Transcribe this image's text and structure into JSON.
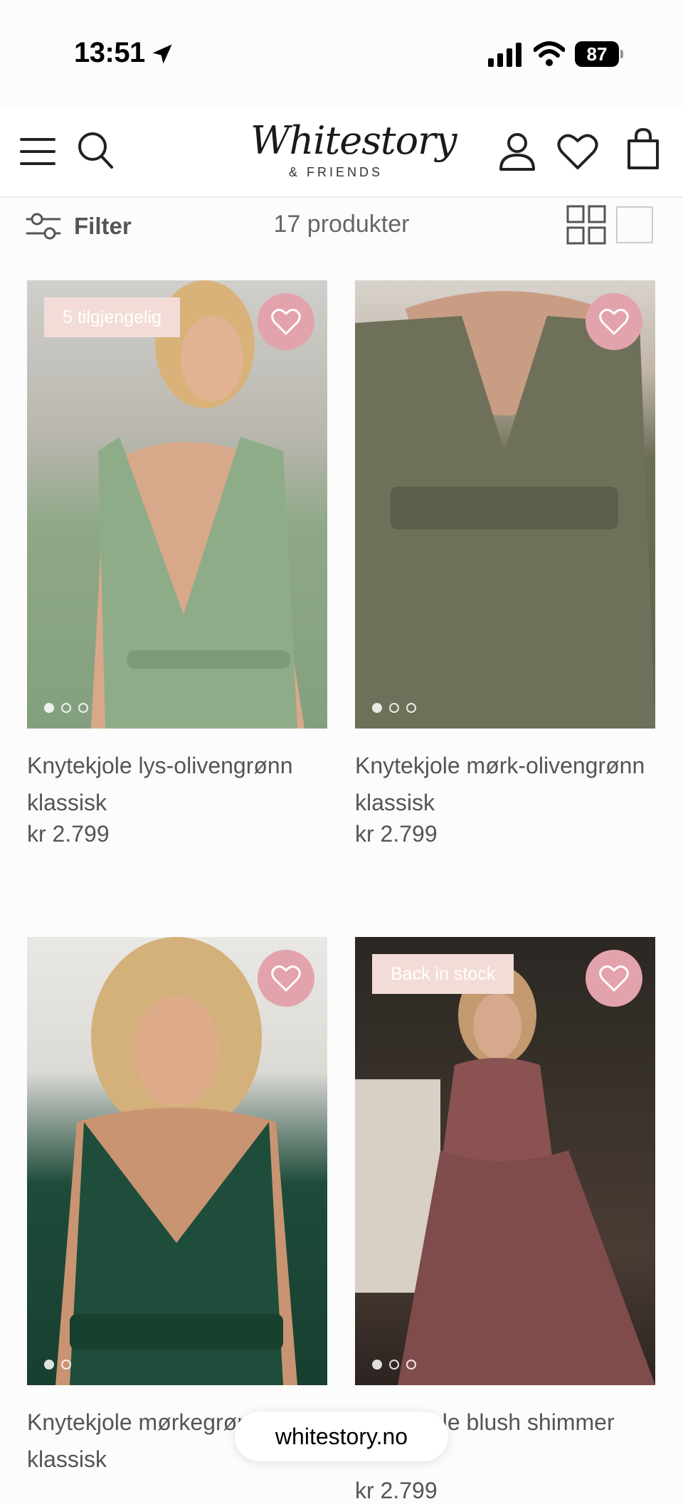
{
  "status_bar": {
    "time": "13:51",
    "battery": "87"
  },
  "header": {
    "logo_script": "Whitestory",
    "logo_sub": "& FRIENDS"
  },
  "toolbar": {
    "filter_label": "Filter",
    "count": "17 produkter"
  },
  "products": [
    {
      "name": "Knytekjole lys-olivengrønn klassisk",
      "price": "kr 2.799",
      "badge": "5 tilgjengelig",
      "color": "#8fa887"
    },
    {
      "name": "Knytekjole mørk-olivengrønn klassisk",
      "price": "kr 2.799",
      "badge": "",
      "color": "#6b6d55"
    },
    {
      "name": "Knytekjole mørkegrønn klassisk",
      "price": "",
      "badge": "",
      "color": "#1e4b3a"
    },
    {
      "name": "Knytekjole blush shimmer",
      "price": "kr 2.799",
      "badge": "Back in stock",
      "color": "#7f4c4b"
    }
  ],
  "browser": {
    "url": "whitestory.no"
  },
  "colors": {
    "accent_pink": "#e3a3ac",
    "badge_bg": "#f3dcd8"
  }
}
